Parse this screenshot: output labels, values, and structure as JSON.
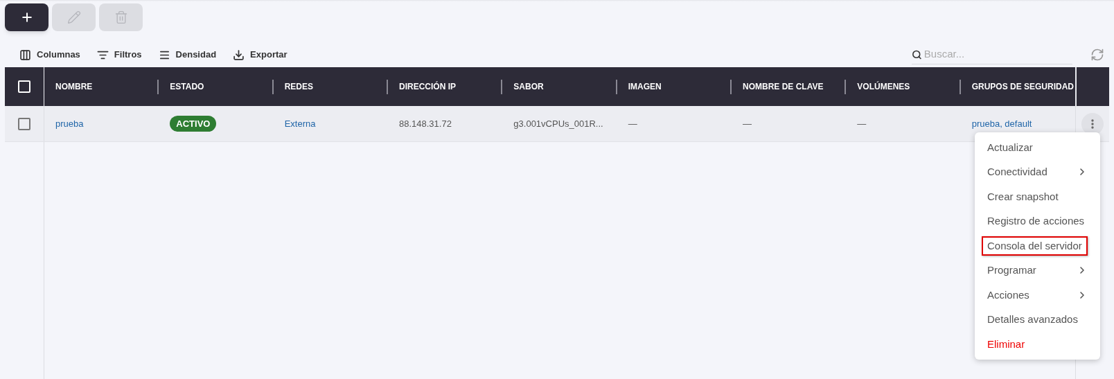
{
  "toolbar_buttons": [
    {
      "kind": "add",
      "disabled": false
    },
    {
      "kind": "edit",
      "disabled": true
    },
    {
      "kind": "delete",
      "disabled": true
    }
  ],
  "table_tools": [
    {
      "kind": "columns",
      "label": "Columnas"
    },
    {
      "kind": "filters",
      "label": "Filtros"
    },
    {
      "kind": "density",
      "label": "Densidad"
    },
    {
      "kind": "export",
      "label": "Exportar"
    }
  ],
  "search": {
    "placeholder": "Buscar..."
  },
  "table": {
    "select_all_checked": false,
    "columns": [
      "NOMBRE",
      "ESTADO",
      "REDES",
      "DIRECCIÓN IP",
      "SABOR",
      "IMAGEN",
      "NOMBRE DE CLAVE",
      "VOLÚMENES",
      "GRUPOS DE SEGURIDAD"
    ],
    "rows": [
      {
        "checked": false,
        "cells": [
          {
            "kind": "link",
            "text": "prueba"
          },
          {
            "kind": "badge",
            "text": "ACTIVO"
          },
          {
            "kind": "link",
            "text": "Externa"
          },
          {
            "kind": "text",
            "text": "88.148.31.72"
          },
          {
            "kind": "text",
            "text": "g3.001vCPUs_001R..."
          },
          {
            "kind": "text",
            "text": "—"
          },
          {
            "kind": "text",
            "text": "—"
          },
          {
            "kind": "text",
            "text": "—"
          },
          {
            "kind": "link",
            "text": "prueba, default"
          }
        ]
      }
    ]
  },
  "row_menu": {
    "items": [
      {
        "label": "Actualizar",
        "submenu": false,
        "danger": false,
        "outlined": false
      },
      {
        "label": "Conectividad",
        "submenu": true,
        "danger": false,
        "outlined": false
      },
      {
        "label": "Crear snapshot",
        "submenu": false,
        "danger": false,
        "outlined": false
      },
      {
        "label": "Registro de acciones",
        "submenu": false,
        "danger": false,
        "outlined": false
      },
      {
        "label": "Consola del servidor",
        "submenu": false,
        "danger": false,
        "outlined": true
      },
      {
        "label": "Programar",
        "submenu": true,
        "danger": false,
        "outlined": false
      },
      {
        "label": "Acciones",
        "submenu": true,
        "danger": false,
        "outlined": false
      },
      {
        "label": "Detalles avanzados",
        "submenu": false,
        "danger": false,
        "outlined": false
      },
      {
        "label": "Eliminar",
        "submenu": false,
        "danger": true,
        "outlined": false
      }
    ]
  }
}
